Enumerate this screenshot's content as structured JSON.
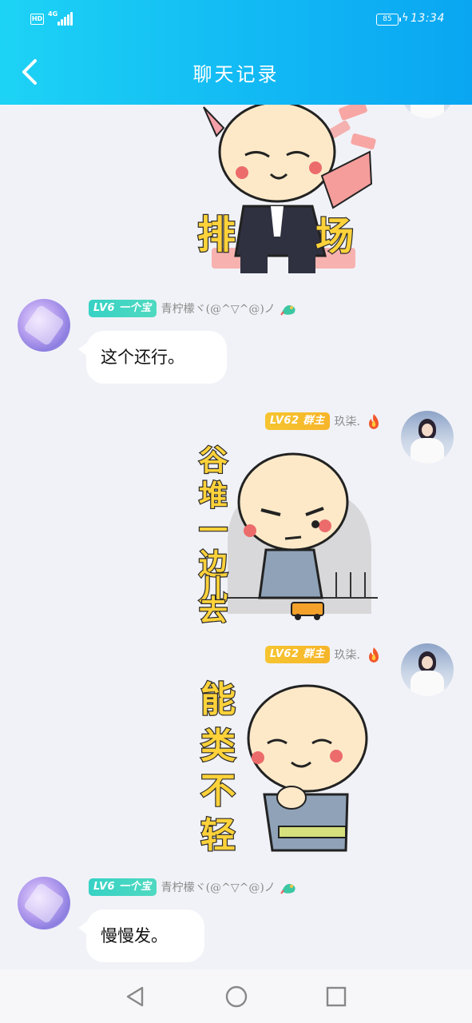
{
  "status_bar": {
    "hd": "HD",
    "network": "4G",
    "battery": "85",
    "time": "13:34"
  },
  "header": {
    "title": "聊天记录"
  },
  "messages": [
    {
      "type": "sticker",
      "side": "right",
      "sticker_text_left": "排",
      "sticker_text_right": "场"
    },
    {
      "type": "text",
      "side": "left",
      "level_badge": "LV6 一个宝",
      "nickname": "青柠檬ヾ(@^▽^@)ノ",
      "text": "这个还行。"
    },
    {
      "type": "sticker",
      "side": "right",
      "level_badge": "LV62 群主",
      "nickname": "玖柒.",
      "sticker_text": "谷堆一边儿去"
    },
    {
      "type": "sticker",
      "side": "right",
      "level_badge": "LV62 群主",
      "nickname": "玖柒.",
      "sticker_text": "能类不轻"
    },
    {
      "type": "text",
      "side": "left",
      "level_badge": "LV6 一个宝",
      "nickname": "青柠檬ヾ(@^▽^@)ノ",
      "text": "慢慢发。"
    }
  ],
  "icons": {
    "back": "back-arrow-icon",
    "nav_back": "triangle-back-icon",
    "nav_home": "circle-home-icon",
    "nav_recent": "square-recent-icon",
    "fire": "fire-icon",
    "dragon": "dragon-icon"
  },
  "colors": {
    "header_start": "#1dd3f5",
    "header_end": "#0aa6f2",
    "badge_member": "#37d2c5",
    "badge_owner": "#f6c530",
    "background": "#f1f2f7"
  }
}
